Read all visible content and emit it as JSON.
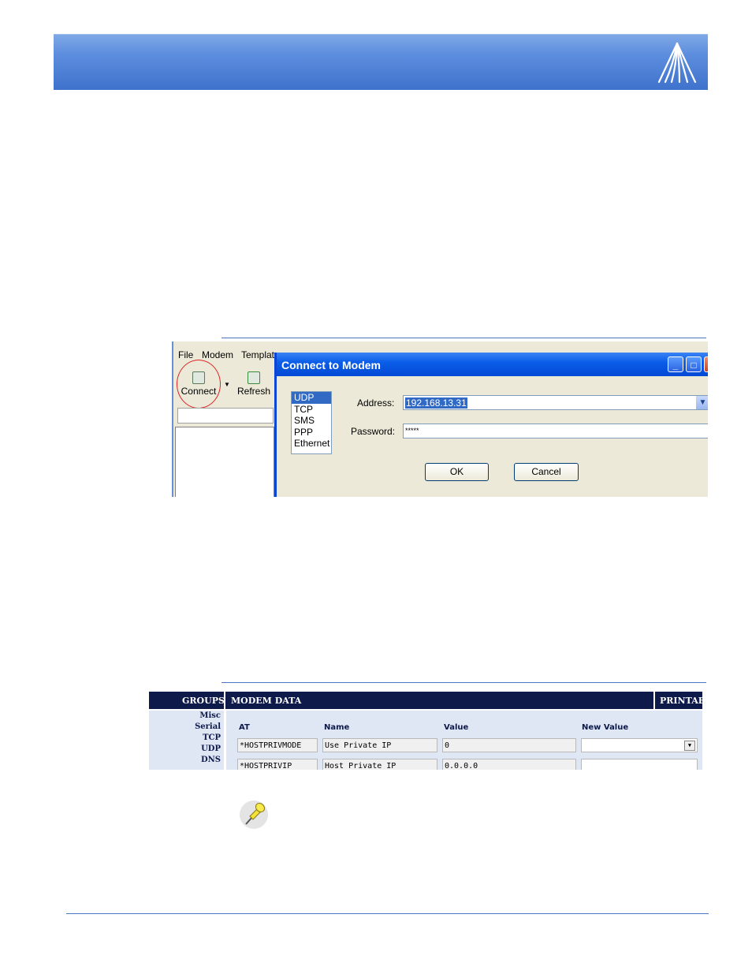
{
  "menu": [
    "File",
    "Modem",
    "Templat"
  ],
  "toolbar": {
    "connect_label": "Connect",
    "refresh_label": "Refresh"
  },
  "dialog": {
    "title": "Connect to Modem",
    "protocols": [
      "UDP",
      "TCP",
      "SMS",
      "PPP",
      "Ethernet"
    ],
    "selected_protocol": "UDP",
    "address_label": "Address:",
    "address_value": "192.168.13.31",
    "password_label": "Password:",
    "password_value": "*****",
    "ok_label": "OK",
    "cancel_label": "Cancel"
  },
  "modem_table": {
    "groups_header": "GROUPS",
    "data_header": "MODEM DATA",
    "printable_header": "PRINTABL",
    "groups": [
      "Misc",
      "Serial",
      "TCP",
      "UDP",
      "DNS"
    ],
    "columns": [
      "AT",
      "Name",
      "Value",
      "New Value"
    ],
    "rows": [
      {
        "at": "*HOSTPRIVMODE",
        "name": "Use Private IP",
        "value": "0",
        "new_value": ""
      },
      {
        "at": "*HOSTPRIVIP",
        "name": "Host Private IP",
        "value": "0.0.0.0",
        "new_value": ""
      }
    ]
  },
  "colors": {
    "banner": "#4f82d6",
    "titlebar": "#0b5ee8",
    "table_header": "#0d1a4a",
    "highlight": "#316ac5"
  }
}
